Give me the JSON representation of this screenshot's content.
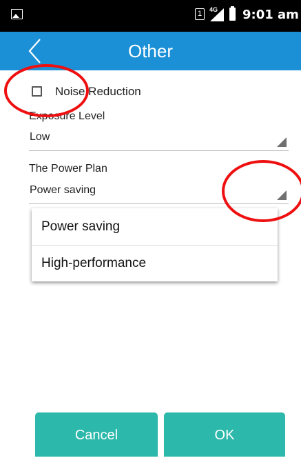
{
  "status_bar": {
    "sim_slot": "1",
    "network": "4G",
    "time": "9:01 am"
  },
  "toolbar": {
    "title": "Other"
  },
  "settings": {
    "noise_reduction_label": "Noise Reduction",
    "noise_reduction_checked": false,
    "exposure_label": "Exposure Level",
    "exposure_value": "Low",
    "power_plan_label": "The Power Plan",
    "power_plan_value": "Power saving"
  },
  "power_plan_dropdown": {
    "options": [
      "Power saving",
      "High-performance"
    ]
  },
  "buttons": {
    "cancel": "Cancel",
    "ok": "OK"
  },
  "colors": {
    "toolbar": "#1b90d6",
    "buttons": "#2cb8aa",
    "annotation": "#ee1010"
  }
}
